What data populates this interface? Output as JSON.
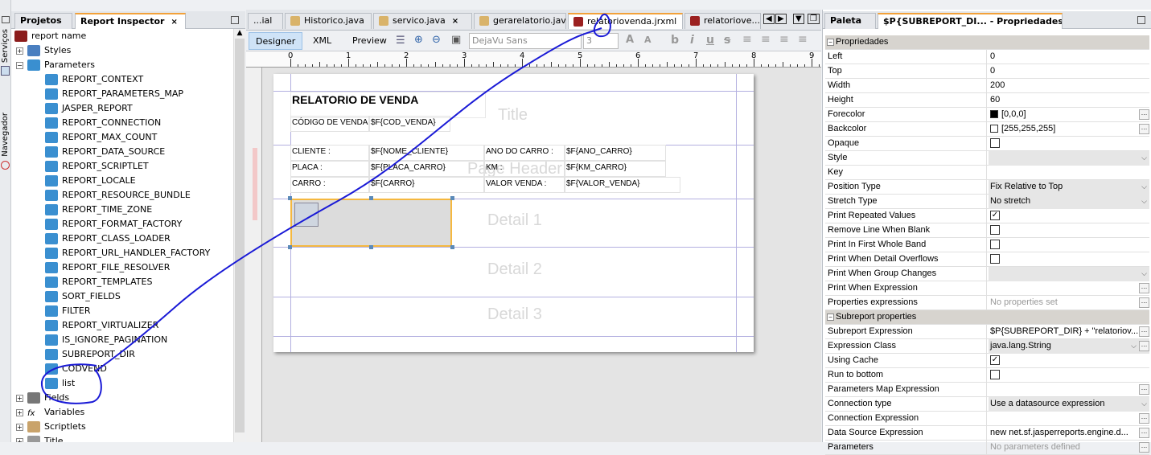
{
  "side_strip": {
    "servicos": "Serviços",
    "navegador": "Navegador"
  },
  "left_panel": {
    "tabs": [
      {
        "label": "Projetos"
      },
      {
        "label": "Report Inspector"
      }
    ],
    "tree": [
      {
        "label": "report name",
        "level": 0,
        "icon": "report-icon"
      },
      {
        "label": "Styles",
        "level": 1,
        "icon": "styles-icon",
        "expander": "+"
      },
      {
        "label": "Parameters",
        "level": 1,
        "icon": "parameter-icon",
        "expander": "-"
      },
      {
        "label": "REPORT_CONTEXT",
        "level": 2,
        "icon": "parameter-icon"
      },
      {
        "label": "REPORT_PARAMETERS_MAP",
        "level": 2,
        "icon": "parameter-icon"
      },
      {
        "label": "JASPER_REPORT",
        "level": 2,
        "icon": "parameter-icon"
      },
      {
        "label": "REPORT_CONNECTION",
        "level": 2,
        "icon": "parameter-icon"
      },
      {
        "label": "REPORT_MAX_COUNT",
        "level": 2,
        "icon": "parameter-icon"
      },
      {
        "label": "REPORT_DATA_SOURCE",
        "level": 2,
        "icon": "parameter-icon"
      },
      {
        "label": "REPORT_SCRIPTLET",
        "level": 2,
        "icon": "parameter-icon"
      },
      {
        "label": "REPORT_LOCALE",
        "level": 2,
        "icon": "parameter-icon"
      },
      {
        "label": "REPORT_RESOURCE_BUNDLE",
        "level": 2,
        "icon": "parameter-icon"
      },
      {
        "label": "REPORT_TIME_ZONE",
        "level": 2,
        "icon": "parameter-icon"
      },
      {
        "label": "REPORT_FORMAT_FACTORY",
        "level": 2,
        "icon": "parameter-icon"
      },
      {
        "label": "REPORT_CLASS_LOADER",
        "level": 2,
        "icon": "parameter-icon"
      },
      {
        "label": "REPORT_URL_HANDLER_FACTORY",
        "level": 2,
        "icon": "parameter-icon"
      },
      {
        "label": "REPORT_FILE_RESOLVER",
        "level": 2,
        "icon": "parameter-icon"
      },
      {
        "label": "REPORT_TEMPLATES",
        "level": 2,
        "icon": "parameter-icon"
      },
      {
        "label": "SORT_FIELDS",
        "level": 2,
        "icon": "parameter-icon"
      },
      {
        "label": "FILTER",
        "level": 2,
        "icon": "parameter-icon"
      },
      {
        "label": "REPORT_VIRTUALIZER",
        "level": 2,
        "icon": "parameter-icon"
      },
      {
        "label": "IS_IGNORE_PAGINATION",
        "level": 2,
        "icon": "parameter-icon"
      },
      {
        "label": "SUBREPORT_DIR",
        "level": 2,
        "icon": "parameter-icon"
      },
      {
        "label": "CODVEND",
        "level": 2,
        "icon": "parameter-icon"
      },
      {
        "label": "list",
        "level": 2,
        "icon": "parameter-icon"
      },
      {
        "label": "Fields",
        "level": 1,
        "icon": "fields-icon",
        "expander": "+"
      },
      {
        "label": "Variables",
        "level": 1,
        "icon": "variables-icon",
        "expander": "+"
      },
      {
        "label": "Scriptlets",
        "level": 1,
        "icon": "scriptlets-icon",
        "expander": "+"
      },
      {
        "label": "Title",
        "level": 1,
        "icon": "band-icon",
        "expander": "+"
      }
    ]
  },
  "editor": {
    "tabs": [
      {
        "label": "...ial",
        "close": false
      },
      {
        "label": "Historico.java"
      },
      {
        "label": "servico.java"
      },
      {
        "label": "gerarelatorio.java"
      },
      {
        "label": "relatoriovenda.jrxml",
        "active": true
      },
      {
        "label": "relatoriove..."
      }
    ],
    "views": {
      "designer": "Designer",
      "xml": "XML",
      "preview": "Preview"
    },
    "font_name": "DejaVu Sans",
    "font_size": "3",
    "ruler_ticks": [
      "0",
      "1",
      "2",
      "3",
      "4",
      "5",
      "6",
      "7",
      "8",
      "9"
    ],
    "report": {
      "title": "RELATORIO DE VENDA",
      "codigo_label": "CÓDIGO DE VENDA",
      "codigo_field": "$F{COD_VENDA}",
      "cliente_label": "CLIENTE :",
      "cliente_field": "$F{NOME_CLIENTE}",
      "ano_label": "ANO DO CARRO :",
      "ano_field": "$F{ANO_CARRO}",
      "placa_label": "PLACA :",
      "placa_field": "$F{PLACA_CARRO}",
      "km_label": "KM :",
      "km_field": "$F{KM_CARRO}",
      "carro_label": "CARRO :",
      "carro_field": "$F{CARRO}",
      "valor_label": "VALOR VENDA :",
      "valor_field": "$F{VALOR_VENDA}",
      "bands": {
        "title": "Title",
        "page_header": "Page Header",
        "detail1": "Detail 1",
        "detail2": "Detail 2",
        "detail3": "Detail 3"
      }
    }
  },
  "right_panel": {
    "tabs": [
      {
        "label": "Paleta"
      },
      {
        "label": "$P{SUBREPORT_DI... - Propriedades"
      }
    ],
    "rows": [
      {
        "header": "Propriedades"
      },
      {
        "k": "Left",
        "v": "0"
      },
      {
        "k": "Top",
        "v": "0"
      },
      {
        "k": "Width",
        "v": "200"
      },
      {
        "k": "Height",
        "v": "60"
      },
      {
        "k": "Forecolor",
        "v": "[0,0,0]",
        "swatch": "#000000",
        "dots": true
      },
      {
        "k": "Backcolor",
        "v": "[255,255,255]",
        "swatch": "#ffffff",
        "dots": true
      },
      {
        "k": "Opaque",
        "check": false
      },
      {
        "k": "Style",
        "v": "",
        "dropdown": true
      },
      {
        "k": "Key",
        "v": ""
      },
      {
        "k": "Position Type",
        "v": "Fix Relative to Top",
        "dropdown": true
      },
      {
        "k": "Stretch Type",
        "v": "No stretch",
        "dropdown": true
      },
      {
        "k": "Print Repeated Values",
        "check": true
      },
      {
        "k": "Remove Line When Blank",
        "check": false
      },
      {
        "k": "Print In First Whole Band",
        "check": false
      },
      {
        "k": "Print When Detail Overflows",
        "check": false
      },
      {
        "k": "Print When Group Changes",
        "v": "",
        "dropdown": true
      },
      {
        "k": "Print When Expression",
        "v": "",
        "dots": true
      },
      {
        "k": "Properties expressions",
        "v": "No properties set",
        "gray": true,
        "dots": true
      },
      {
        "header": "Subreport properties"
      },
      {
        "k": "Subreport Expression",
        "v": "$P{SUBREPORT_DIR} + \"relatoriov...",
        "dots": true
      },
      {
        "k": "Expression Class",
        "v": "java.lang.String",
        "dropdown": true,
        "dots": true
      },
      {
        "k": "Using Cache",
        "check": true
      },
      {
        "k": "Run to bottom",
        "check": false
      },
      {
        "k": "Parameters Map Expression",
        "v": "",
        "dots": true
      },
      {
        "k": "Connection type",
        "v": "Use a datasource expression",
        "dropdown": true
      },
      {
        "k": "Connection Expression",
        "v": "",
        "dots": true
      },
      {
        "k": "Data Source Expression",
        "v": "new net.sf.jasperreports.engine.d...",
        "dots": true
      },
      {
        "k": "Parameters",
        "v": "No parameters defined",
        "gray": true,
        "dots": true
      }
    ]
  },
  "colors": {
    "accent_tab": "#f2a13a",
    "annotation": "#1a1ad6",
    "selection": "#f5b840"
  }
}
